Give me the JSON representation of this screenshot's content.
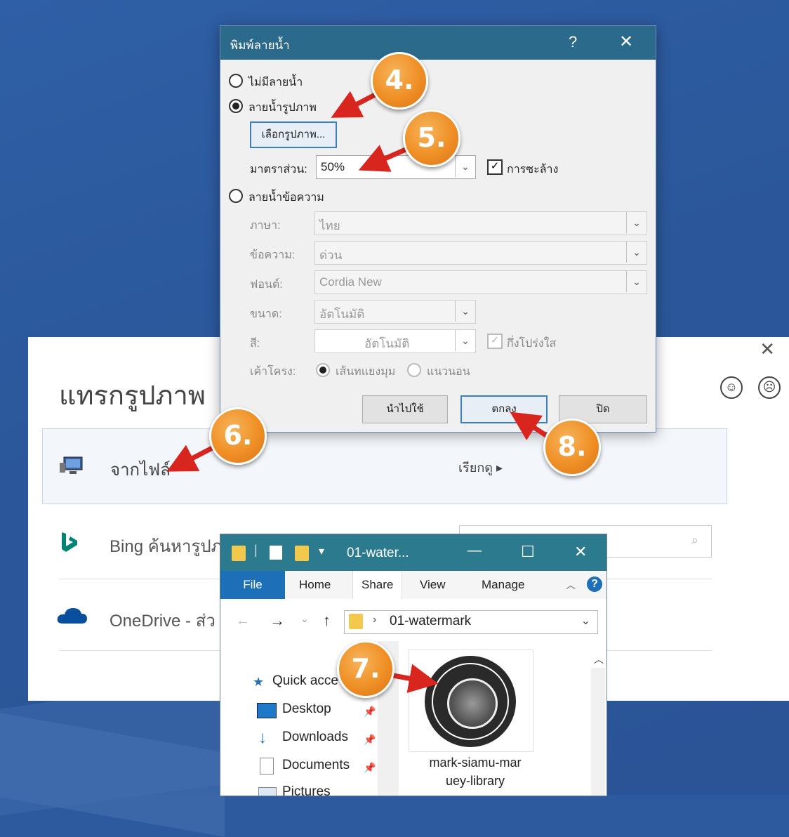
{
  "insert_panel": {
    "title": "แทรกรูปภาพ",
    "close": "✕",
    "smile": "☺",
    "frown": "☹",
    "from_file_label": "จากไฟล์",
    "browse_label": "เรียกดู ▸",
    "bing_label": "Bing ค้นหารูปภ",
    "onedrive_label": "OneDrive - ส่ว",
    "search_icon": "⌕"
  },
  "dialog": {
    "title": "พิมพ์ลายน้ำ",
    "help": "?",
    "close": "✕",
    "no_watermark": "ไม่มีลายน้ำ",
    "picture_watermark": "ลายน้ำรูปภาพ",
    "select_picture": "เลือกรูปภาพ...",
    "scale_label": "มาตราส่วน:",
    "scale_value": "50%",
    "washout_label": "การซะล้าง",
    "text_watermark": "ลายน้ำข้อความ",
    "language_label": "ภาษา:",
    "language_value": "ไทย",
    "text_label": "ข้อความ:",
    "text_value": "ด่วน",
    "font_label": "ฟอนต์:",
    "font_value": "Cordia New",
    "size_label": "ขนาด:",
    "size_value": "อัตโนมัติ",
    "color_label": "สี:",
    "color_value": "อัตโนมัติ",
    "semitransparent_label": "กึ่งโปร่งใส",
    "layout_label": "เค้าโครง:",
    "diagonal_label": "เส้นทแยงมุม",
    "horizontal_label": "แนวนอน",
    "apply_button": "นำไปใช้",
    "ok_button": "ตกลง",
    "close_button": "ปิด"
  },
  "explorer": {
    "title": "01-water...",
    "minimize": "—",
    "maximize": "☐",
    "close": "✕",
    "tabs": [
      "File",
      "Home",
      "Share",
      "View",
      "Manage"
    ],
    "address": "01-watermark",
    "nav_items": [
      "Quick acce",
      "Desktop",
      "Downloads",
      "Documents",
      "Pictures"
    ],
    "file_name_line1": "mark-siamu-mar",
    "file_name_line2": "uey-library"
  },
  "steps": [
    "4.",
    "5.",
    "6.",
    "7.",
    "8."
  ],
  "colors": {
    "background": "#2b579a",
    "dialog_title": "#2b6a8a",
    "explorer_title": "#2c7a8e",
    "file_tab": "#1d6fb8",
    "step_marker": "#ef8f25",
    "arrow": "#d8261f"
  }
}
